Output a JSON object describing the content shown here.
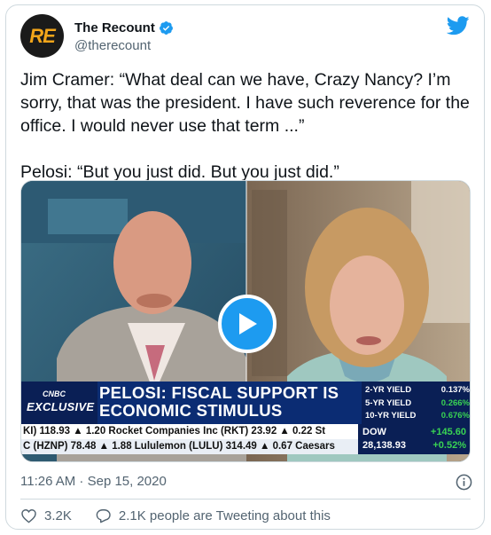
{
  "account": {
    "avatar_text": "RE",
    "display_name": "The Recount",
    "handle": "@therecount",
    "verified": true
  },
  "tweet": {
    "text": "Jim Cramer: “What deal can we have, Crazy Nancy? I’m sorry, that was the president. I have such reverence for the office. I would never use that term ...”\n\nPelosi: “But you just did. But you just did.”",
    "timestamp": "11:26 AM · Sep 15, 2020"
  },
  "video": {
    "cnbc_label": "CNBC",
    "exclusive_label": "EXCLUSIVE",
    "headline": "PELOSI: FISCAL SUPPORT IS ECONOMIC STIMULUS",
    "yields": [
      {
        "label": "2-YR YIELD",
        "value": "0.137%"
      },
      {
        "label": "5-YR YIELD",
        "value": "0.266%"
      },
      {
        "label": "10-YR YIELD",
        "value": "0.676%"
      }
    ],
    "ticker_line_1": "KI) 118.93 ▲ 1.20   Rocket Companies Inc (RKT) 23.92 ▲ 0.22   St",
    "ticker_line_2": "C (HZNP) 78.48 ▲ 1.88   Lululemon (LULU) 314.49 ▲ 0.67   Caesars",
    "dow_label": "DOW",
    "dow_value": "28,138.93",
    "dow_change": "+145.60",
    "dow_percent": "+0.52%"
  },
  "actions": {
    "likes": "3.2K",
    "conversation": "2.1K people are Tweeting about this"
  },
  "colors": {
    "accent": "#1d9bf0",
    "text_secondary": "#536471",
    "border": "#cfd9de"
  }
}
